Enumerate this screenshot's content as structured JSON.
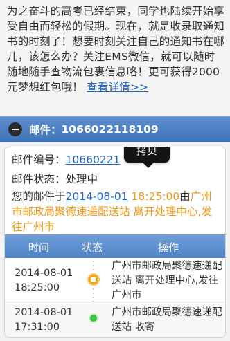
{
  "intro": {
    "text": "为之奋斗的高考已经结束，同学也陆续开始享受自由而轻松的假期。现在，就是收录取通知书的时刻了！想要时刻关注自己的通知书在哪儿，该怎么办？关注EMS微信，就可以随时随地随手查物流包裹信息咯！更可获得2000元梦想红包哦！",
    "link": "查看详情>>"
  },
  "header": {
    "label": "邮件：",
    "number": "1066022118109"
  },
  "detail": {
    "id_label": "邮件编号：",
    "id_value": "10660221",
    "status_label": "邮件状态：",
    "status_value": "处理中",
    "prefix": "您的邮件于",
    "date": "2014-08-01",
    "time": "18:25:00",
    "mid": "由",
    "place": "广州市邮政局聚德速递配送站 离开处理中心,发往广州市"
  },
  "tooltip": {
    "label": "拷贝"
  },
  "table": {
    "headers": [
      "时间",
      "状态",
      "操作"
    ],
    "rows": [
      {
        "date": "2014-08-01",
        "time": "18:25:00",
        "status_icon": "truck-icon",
        "op": "广州市邮政局聚德速递配送站 离开处理中心,发往广州市"
      },
      {
        "date": "2014-08-01",
        "time": "17:31:00",
        "status_icon": "check-dot-icon",
        "op": "广州市邮政局聚德速递配送站 收寄"
      }
    ]
  },
  "colors": {
    "header_blue": "#4a7ec2",
    "link_blue": "#1f63c6",
    "orange": "#f09a12",
    "green": "#3fbf3f"
  }
}
